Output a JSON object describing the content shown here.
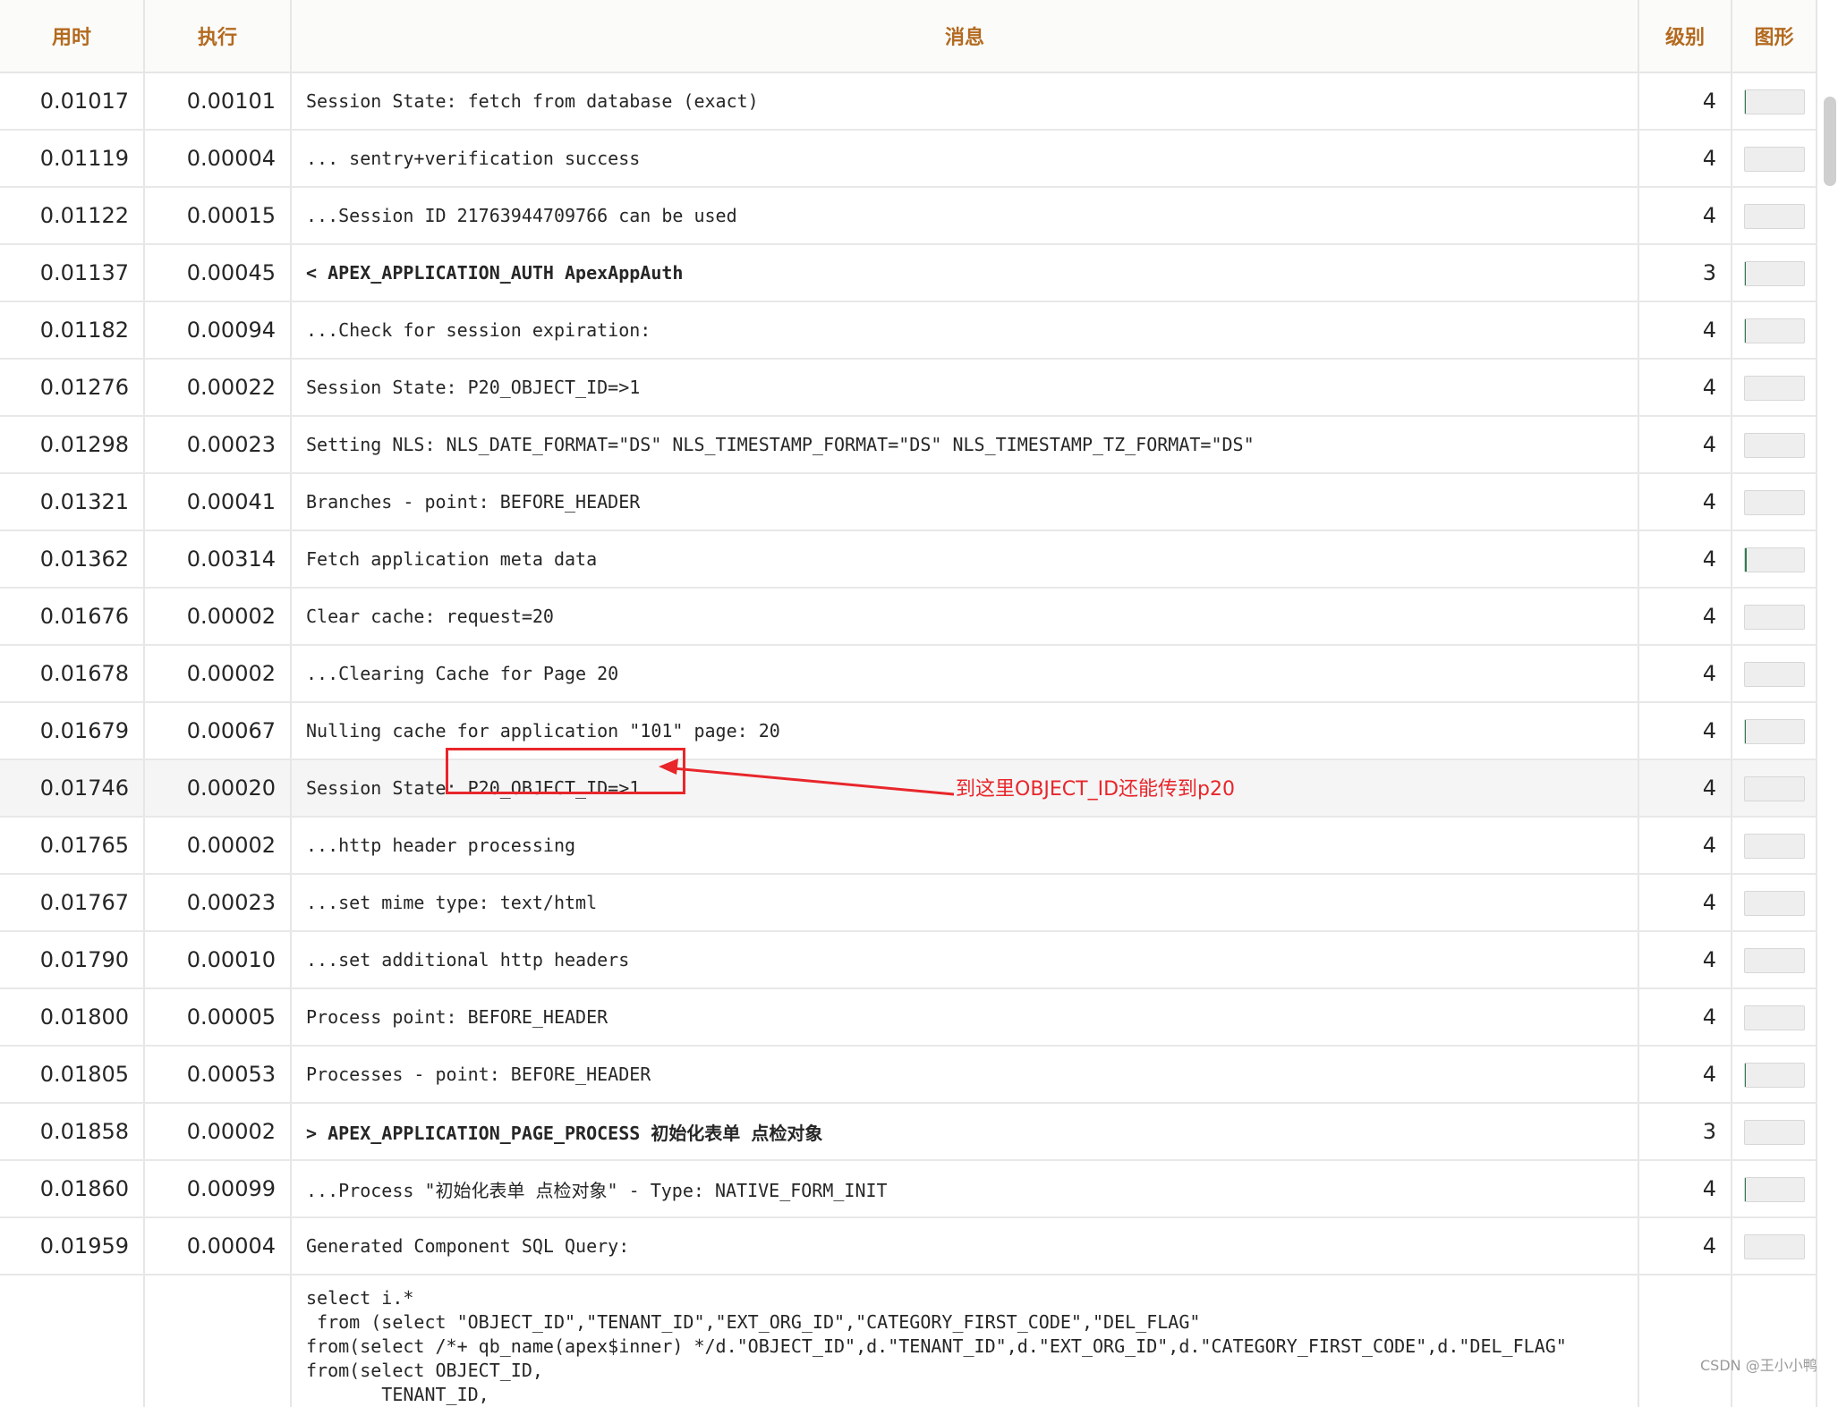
{
  "table": {
    "headers": {
      "elapsed": "用时",
      "execution": "执行",
      "message": "消息",
      "level": "级别",
      "graph": "图形"
    },
    "rows": [
      {
        "elapsed": "0.01017",
        "execution": "0.00101",
        "message": "Session State: fetch from database (exact)",
        "level": "4",
        "bar_fraction": 0.03
      },
      {
        "elapsed": "0.01119",
        "execution": "0.00004",
        "message": "... sentry+verification success",
        "level": "4",
        "bar_fraction": 0.0
      },
      {
        "elapsed": "0.01122",
        "execution": "0.00015",
        "message": "...Session ID 21763944709766 can be used",
        "level": "4",
        "bar_fraction": 0.0
      },
      {
        "elapsed": "0.01137",
        "execution": "0.00045",
        "message": "< APEX_APPLICATION_AUTH ApexAppAuth",
        "level": "3",
        "bar_fraction": 0.01,
        "bold": true
      },
      {
        "elapsed": "0.01182",
        "execution": "0.00094",
        "message": "...Check for session expiration:",
        "level": "4",
        "bar_fraction": 0.03
      },
      {
        "elapsed": "0.01276",
        "execution": "0.00022",
        "message": "Session State: P20_OBJECT_ID=>1",
        "level": "4",
        "bar_fraction": 0.0
      },
      {
        "elapsed": "0.01298",
        "execution": "0.00023",
        "message": "Setting NLS: NLS_DATE_FORMAT=\"DS\" NLS_TIMESTAMP_FORMAT=\"DS\" NLS_TIMESTAMP_TZ_FORMAT=\"DS\"",
        "level": "4",
        "bar_fraction": 0.0
      },
      {
        "elapsed": "0.01321",
        "execution": "0.00041",
        "message": "Branches - point: BEFORE_HEADER",
        "level": "4",
        "bar_fraction": 0.0
      },
      {
        "elapsed": "0.01362",
        "execution": "0.00314",
        "message": "Fetch application meta data",
        "level": "4",
        "bar_fraction": 0.04
      },
      {
        "elapsed": "0.01676",
        "execution": "0.00002",
        "message": "Clear cache: request=20",
        "level": "4",
        "bar_fraction": 0.0
      },
      {
        "elapsed": "0.01678",
        "execution": "0.00002",
        "message": "...Clearing Cache for Page 20",
        "level": "4",
        "bar_fraction": 0.0
      },
      {
        "elapsed": "0.01679",
        "execution": "0.00067",
        "message": "Nulling cache for application \"101\" page: 20",
        "level": "4",
        "bar_fraction": 0.02
      },
      {
        "elapsed": "0.01746",
        "execution": "0.00020",
        "message": "Session State: P20_OBJECT_ID=>1",
        "level": "4",
        "bar_fraction": 0.0,
        "highlighted": true
      },
      {
        "elapsed": "0.01765",
        "execution": "0.00002",
        "message": "...http header processing",
        "level": "4",
        "bar_fraction": 0.0
      },
      {
        "elapsed": "0.01767",
        "execution": "0.00023",
        "message": "...set mime type: text/html",
        "level": "4",
        "bar_fraction": 0.0
      },
      {
        "elapsed": "0.01790",
        "execution": "0.00010",
        "message": "...set additional http headers",
        "level": "4",
        "bar_fraction": 0.0
      },
      {
        "elapsed": "0.01800",
        "execution": "0.00005",
        "message": "Process point: BEFORE_HEADER",
        "level": "4",
        "bar_fraction": 0.0
      },
      {
        "elapsed": "0.01805",
        "execution": "0.00053",
        "message": "Processes - point: BEFORE_HEADER",
        "level": "4",
        "bar_fraction": 0.02
      },
      {
        "elapsed": "0.01858",
        "execution": "0.00002",
        "message": "> APEX_APPLICATION_PAGE_PROCESS 初始化表单 点检对象",
        "level": "3",
        "bar_fraction": 0.0,
        "bold": true
      },
      {
        "elapsed": "0.01860",
        "execution": "0.00099",
        "message": "...Process \"初始化表单 点检对象\" - Type: NATIVE_FORM_INIT",
        "level": "4",
        "bar_fraction": 0.03
      },
      {
        "elapsed": "0.01959",
        "execution": "0.00004",
        "message": "Generated Component SQL Query:",
        "level": "4",
        "bar_fraction": 0.0
      }
    ],
    "sql_block": "select i.*\n from (select \"OBJECT_ID\",\"TENANT_ID\",\"EXT_ORG_ID\",\"CATEGORY_FIRST_CODE\",\"DEL_FLAG\"\nfrom(select /*+ qb_name(apex$inner) */d.\"OBJECT_ID\",d.\"TENANT_ID\",d.\"EXT_ORG_ID\",d.\"CATEGORY_FIRST_CODE\",d.\"DEL_FLAG\"\nfrom(select OBJECT_ID,\n       TENANT_ID,"
  },
  "annotation": {
    "text": "到这里OBJECT_ID还能传到p20",
    "color": "#e8262b"
  },
  "watermark": "CSDN @王小小鸭",
  "colors": {
    "header_text": "#b36a1f",
    "bar_fill": "#2e7d4f",
    "bar_bg": "#eeeeee",
    "grid": "#e6e6e6"
  }
}
